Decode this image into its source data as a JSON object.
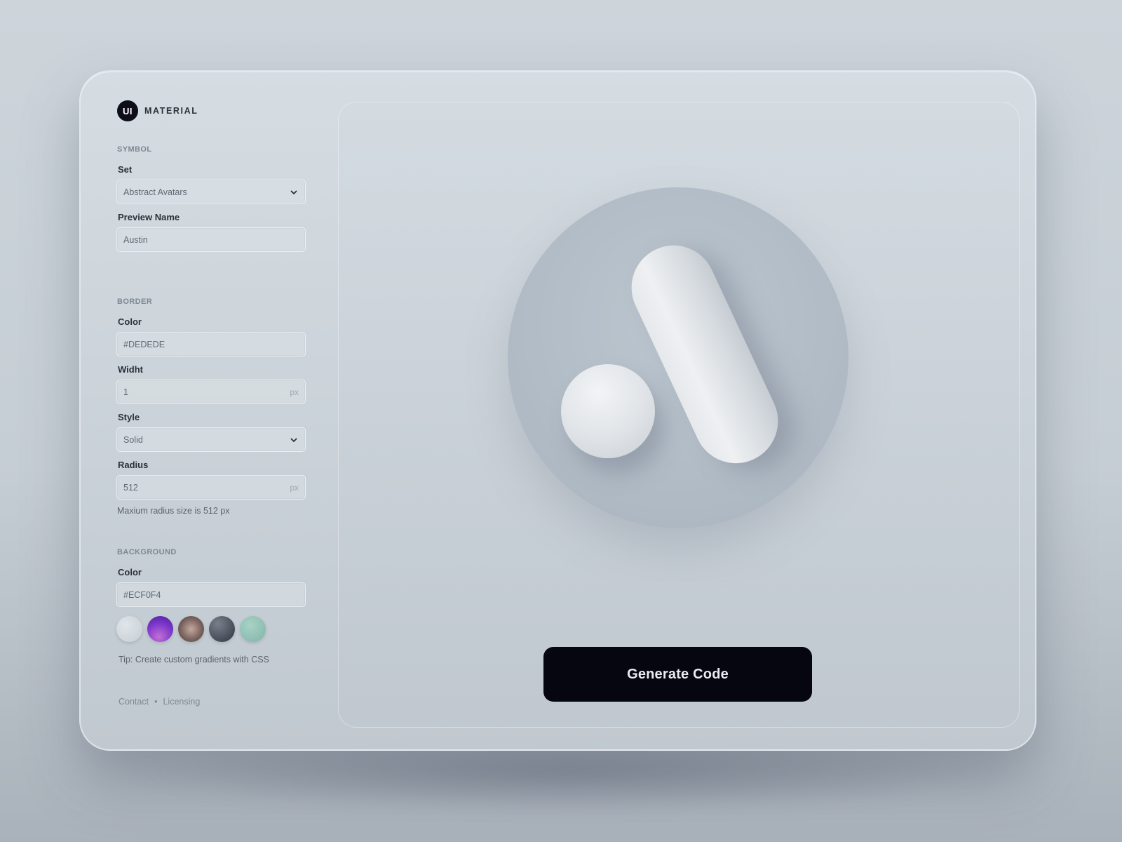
{
  "brand": {
    "badge": "UI",
    "name": "MATERIAL"
  },
  "symbol": {
    "section_title": "SYMBOL",
    "set_label": "Set",
    "set_value": "Abstract Avatars",
    "preview_name_label": "Preview Name",
    "preview_name_value": "Austin"
  },
  "border": {
    "section_title": "BORDER",
    "color_label": "Color",
    "color_value": "#DEDEDE",
    "width_label": "Widht",
    "width_value": "1",
    "width_unit": "px",
    "style_label": "Style",
    "style_value": "Solid",
    "radius_label": "Radius",
    "radius_value": "512",
    "radius_unit": "px",
    "radius_helper": "Maxium radius size is 512 px"
  },
  "background": {
    "section_title": "BACKGROUND",
    "color_label": "Color",
    "color_value": "#ECF0F4",
    "swatches": [
      "gray-light",
      "purple-gradient",
      "brown-gradient",
      "slate-dark",
      "mint"
    ],
    "tip": "Tip: Create custom gradients with CSS"
  },
  "footer": {
    "contact": "Contact",
    "separator": "•",
    "licensing": "Licensing"
  },
  "preview": {
    "generate_label": "Generate Code"
  },
  "icons": {
    "dropdown": "chevron-down-icon"
  },
  "colors": {
    "button_bg": "#05060F",
    "brand_badge_bg": "#0D0E18"
  }
}
